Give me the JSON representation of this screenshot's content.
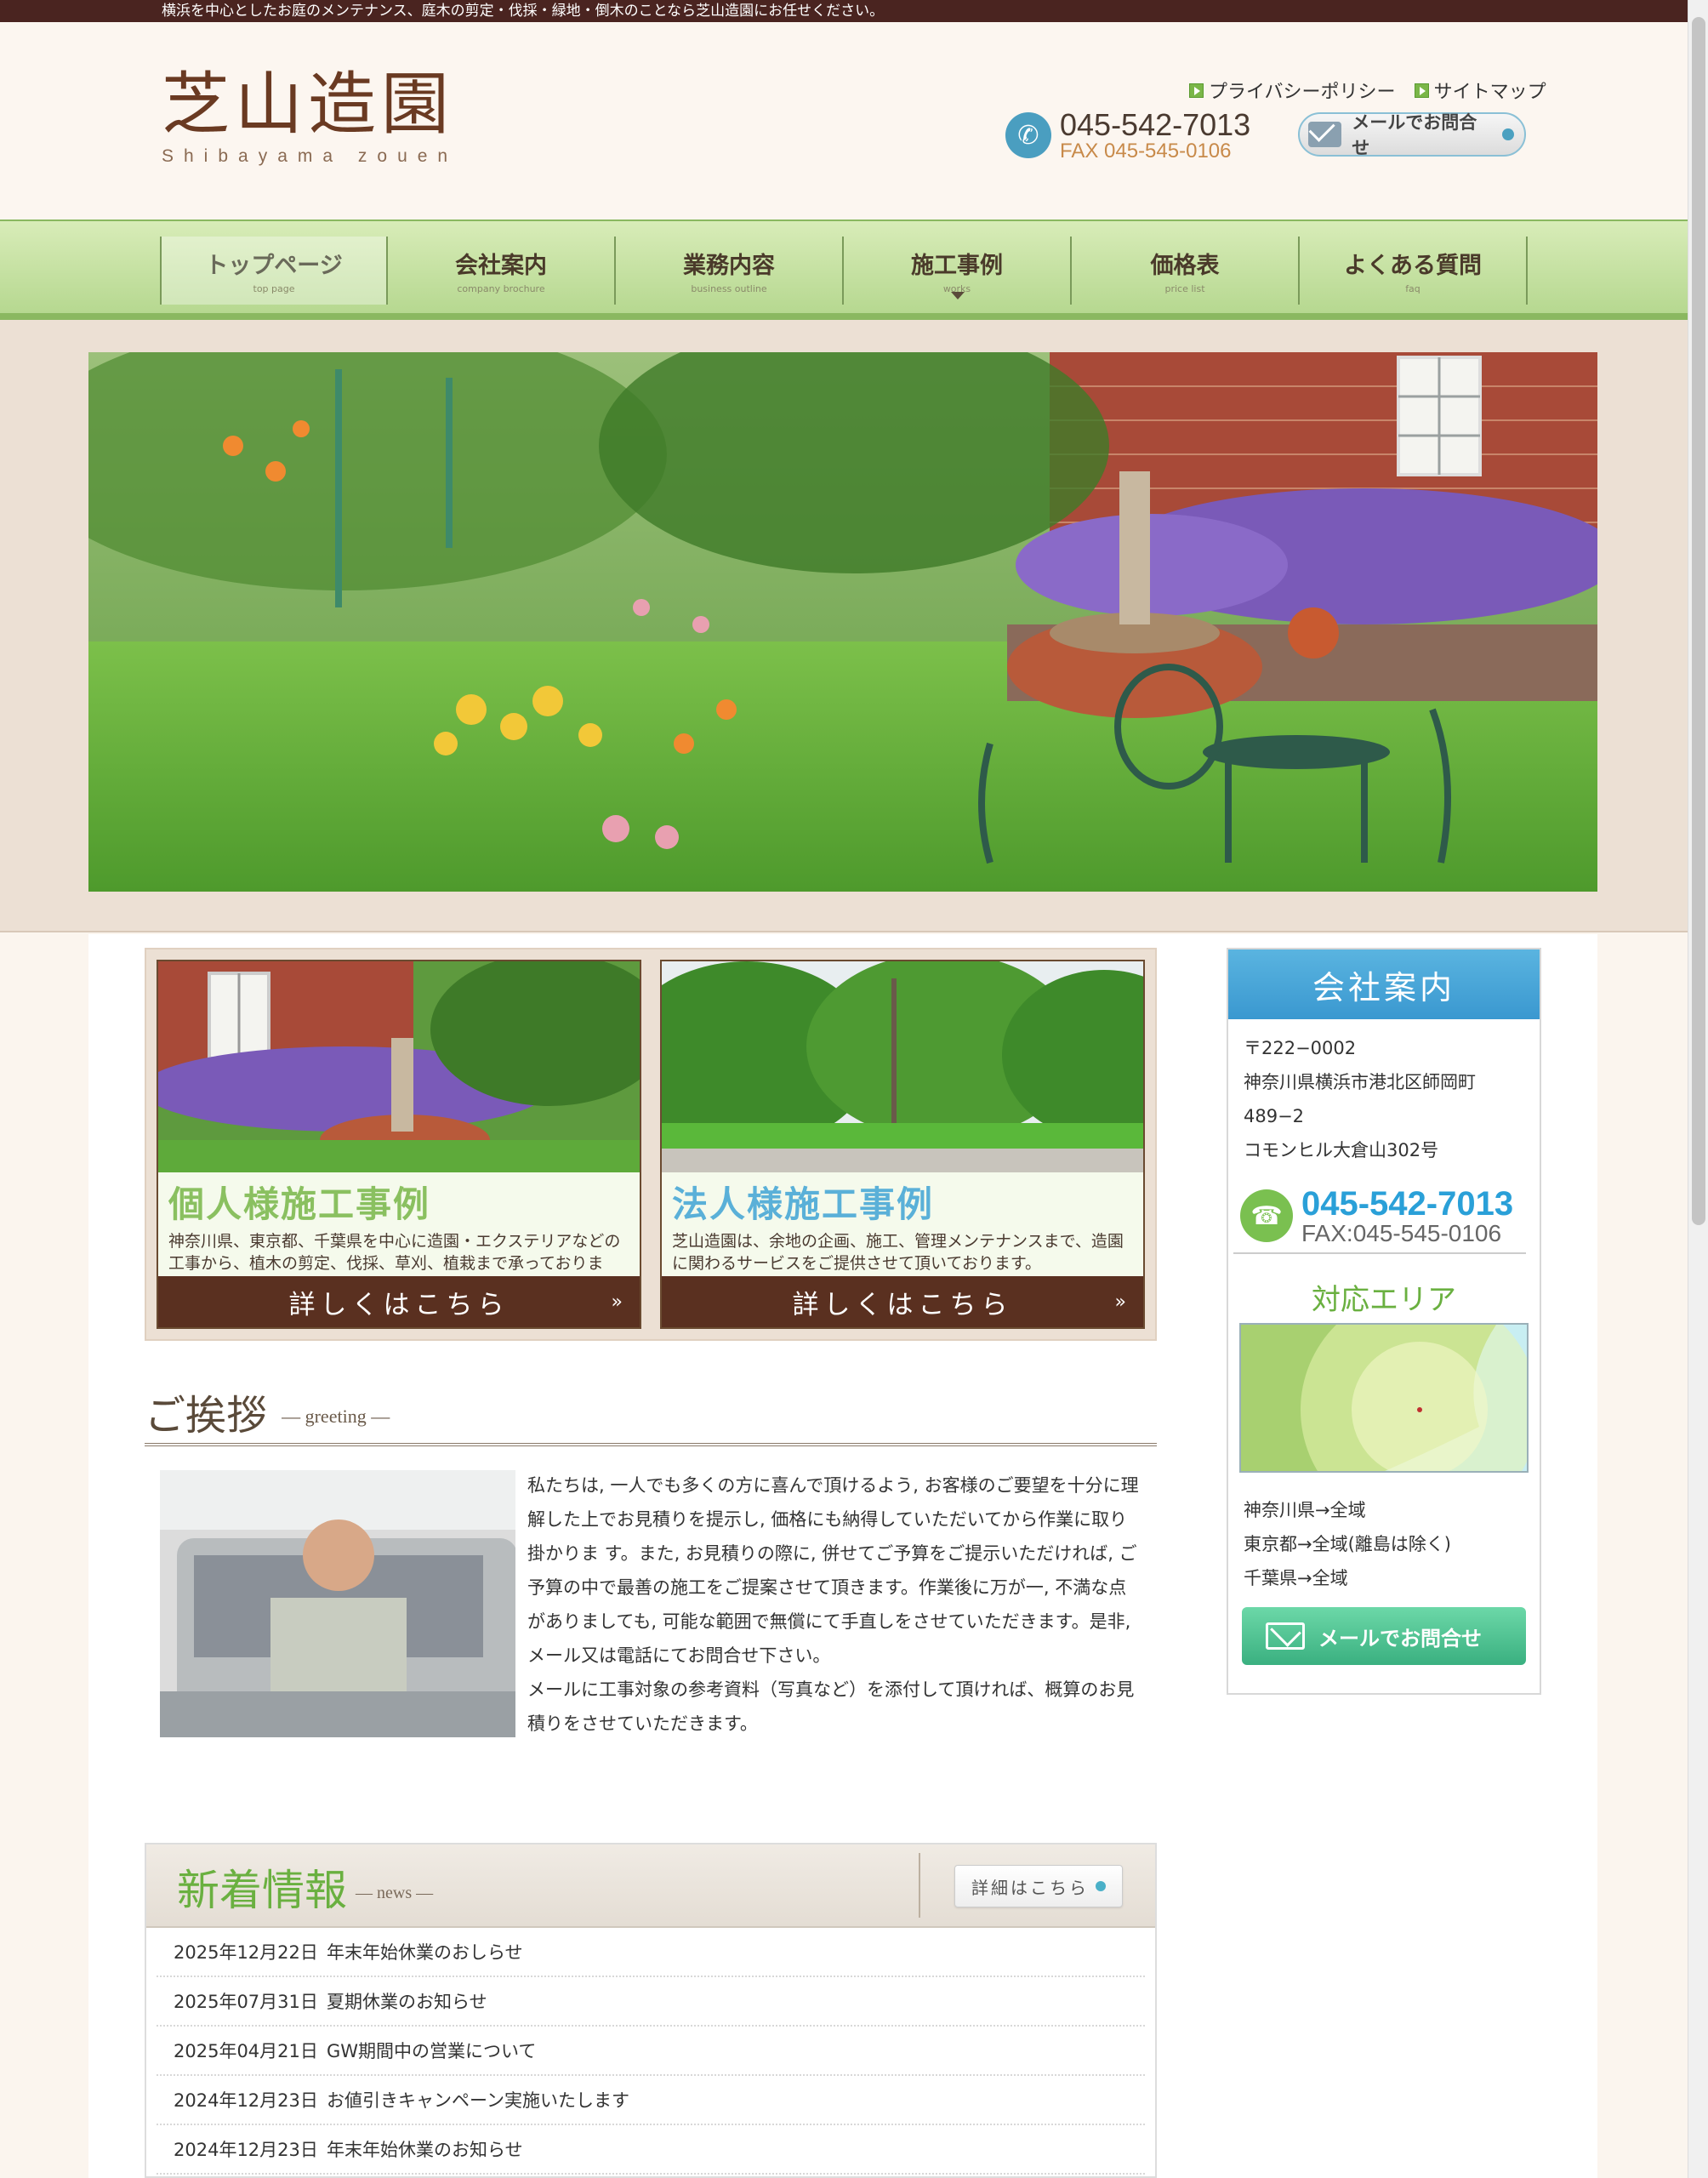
{
  "top_strip": "横浜を中心としたお庭のメンテナンス、庭木の剪定・伐採・緑地・倒木のことなら芝山造園にお任せください。",
  "logo": {
    "kanji": "芝山造園",
    "roman": "Shibayama zouen"
  },
  "top_links": [
    {
      "label": "プライバシーポリシー"
    },
    {
      "label": "サイトマップ"
    }
  ],
  "contact": {
    "tel": "045-542-7013",
    "fax": "FAX 045-545-0106",
    "mail_button": "メールでお問合せ"
  },
  "nav": [
    {
      "label": "トップページ",
      "sub": "top page"
    },
    {
      "label": "会社案内",
      "sub": "company brochure"
    },
    {
      "label": "業務内容",
      "sub": "business outline"
    },
    {
      "label": "施工事例",
      "sub": "works"
    },
    {
      "label": "価格表",
      "sub": "price list"
    },
    {
      "label": "よくある質問",
      "sub": "faq"
    }
  ],
  "cards": [
    {
      "title": "個人様施工事例",
      "text": "神奈川県、東京都、千葉県を中心に造園・エクステリアなどの工事から、植木の剪定、伐採、草刈、植栽まで承っております。",
      "more": "詳しくはこちら"
    },
    {
      "title": "法人様施工事例",
      "text": "芝山造園は、余地の企画、施工、管理メンテナンスまで、造園に関わるサービスをご提供させて頂いております。",
      "more": "詳しくはこちら"
    }
  ],
  "greeting": {
    "title": "ご挨拶",
    "sub": "— greeting —",
    "paragraph1": "私たちは, 一人でも多くの方に喜んで頂けるよう, お客様のご要望を十分に理解した上でお見積りを提示し, 価格にも納得していただいてから作業に取り掛かりま す。また, お見積りの際に, 併せてご予算をご提示いただければ, ご予算の中で最善の施工をご提案させて頂きます。作業後に万が一, 不満な点がありましても, 可能な範囲で無償にて手直しをさせていただきます。是非, メール又は電話にてお問合せ下さい。",
    "paragraph2": "メールに工事対象の参考資料（写真など）を添付して頂ければ、概算のお見積りをさせていただきます。"
  },
  "news": {
    "title": "新着情報",
    "sub": "— news —",
    "more": "詳細はこちら",
    "items": [
      {
        "date": "2025年12月22日",
        "title": "年末年始休業のおしらせ"
      },
      {
        "date": "2025年07月31日",
        "title": "夏期休業のお知らせ"
      },
      {
        "date": "2025年04月21日",
        "title": "GW期間中の営業について"
      },
      {
        "date": "2024年12月23日",
        "title": "お値引きキャンペーン実施いたします"
      },
      {
        "date": "2024年12月23日",
        "title": "年末年始休業のお知らせ"
      }
    ]
  },
  "sidebar": {
    "title": "会社案内",
    "address": [
      "〒222−0002",
      "神奈川県横浜市港北区師岡町",
      "489−2",
      "コモンヒル大倉山302号"
    ],
    "tel": "045-542-7013",
    "fax": "FAX:045-545-0106",
    "area_title": "対応エリア",
    "areas": [
      "神奈川県→全域",
      "東京都→全域(離島は除く)",
      "千葉県→全域"
    ],
    "mail_button": "メールでお問合せ"
  },
  "colors": {
    "brand_brown": "#5a3020",
    "nav_green": "#b6d890",
    "accent_blue": "#3a98d0",
    "accent_green": "#6ab040"
  }
}
